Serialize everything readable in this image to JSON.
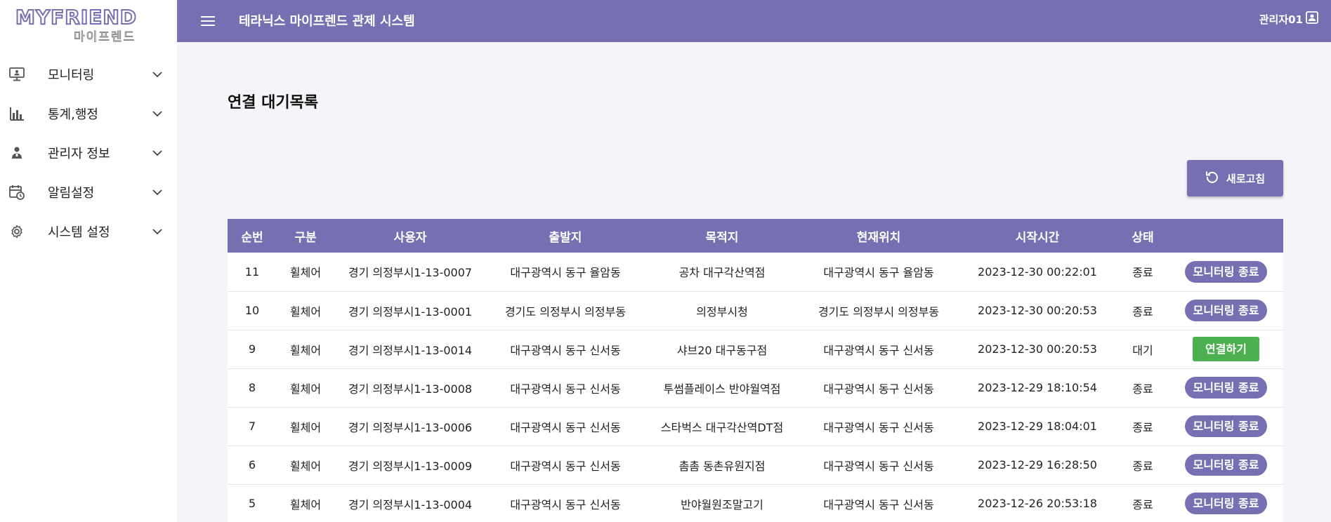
{
  "logo": {
    "main": "MYFRIEND",
    "sub": "마이프렌드"
  },
  "sidebar": {
    "items": [
      {
        "label": "모니터링",
        "icon": "monitor-icon"
      },
      {
        "label": "통계,행정",
        "icon": "bar-chart-icon"
      },
      {
        "label": "관리자 정보",
        "icon": "admin-icon"
      },
      {
        "label": "알림설정",
        "icon": "notification-calendar-icon"
      },
      {
        "label": "시스템 설정",
        "icon": "gear-icon"
      }
    ]
  },
  "header": {
    "title": "테라닉스 마이프렌드 관제 시스템",
    "user": "관리자01"
  },
  "main": {
    "title": "연결 대기목록",
    "refresh_label": "새로고침"
  },
  "table": {
    "columns": [
      "순번",
      "구분",
      "사용자",
      "출발지",
      "목적지",
      "현재위치",
      "시작시간",
      "상태",
      ""
    ],
    "rows": [
      {
        "no": "11",
        "type": "휠체어",
        "user": "경기 의정부시1-13-0007",
        "origin": "대구광역시 동구 율암동",
        "dest": "공차 대구각산역점",
        "current": "대구광역시 동구 율암동",
        "start": "2023-12-30 00:22:01",
        "status": "종료",
        "action": "모니터링 종료",
        "action_kind": "end"
      },
      {
        "no": "10",
        "type": "휠체어",
        "user": "경기 의정부시1-13-0001",
        "origin": "경기도 의정부시 의정부동",
        "dest": "의정부시청",
        "current": "경기도 의정부시 의정부동",
        "start": "2023-12-30 00:20:53",
        "status": "종료",
        "action": "모니터링 종료",
        "action_kind": "end"
      },
      {
        "no": "9",
        "type": "휠체어",
        "user": "경기 의정부시1-13-0014",
        "origin": "대구광역시 동구 신서동",
        "dest": "샤브20 대구동구점",
        "current": "대구광역시 동구 신서동",
        "start": "2023-12-30 00:20:53",
        "status": "대기",
        "action": "연결하기",
        "action_kind": "connect"
      },
      {
        "no": "8",
        "type": "휠체어",
        "user": "경기 의정부시1-13-0008",
        "origin": "대구광역시 동구 신서동",
        "dest": "투썸플레이스 반야월역점",
        "current": "대구광역시 동구 신서동",
        "start": "2023-12-29 18:10:54",
        "status": "종료",
        "action": "모니터링 종료",
        "action_kind": "end"
      },
      {
        "no": "7",
        "type": "휠체어",
        "user": "경기 의정부시1-13-0006",
        "origin": "대구광역시 동구 신서동",
        "dest": "스타벅스 대구각산역DT점",
        "current": "대구광역시 동구 신서동",
        "start": "2023-12-29 18:04:01",
        "status": "종료",
        "action": "모니터링 종료",
        "action_kind": "end"
      },
      {
        "no": "6",
        "type": "휠체어",
        "user": "경기 의정부시1-13-0009",
        "origin": "대구광역시 동구 신서동",
        "dest": "촘촘 동촌유원지점",
        "current": "대구광역시 동구 신서동",
        "start": "2023-12-29 16:28:50",
        "status": "종료",
        "action": "모니터링 종료",
        "action_kind": "end"
      },
      {
        "no": "5",
        "type": "휠체어",
        "user": "경기 의정부시1-13-0004",
        "origin": "대구광역시 동구 신서동",
        "dest": "반야월원조말고기",
        "current": "대구광역시 동구 신서동",
        "start": "2023-12-26 20:53:18",
        "status": "종료",
        "action": "모니터링 종료",
        "action_kind": "end"
      }
    ]
  },
  "colors": {
    "primary": "#7670b3",
    "connect": "#4caf50",
    "background": "#f5f4f8"
  }
}
